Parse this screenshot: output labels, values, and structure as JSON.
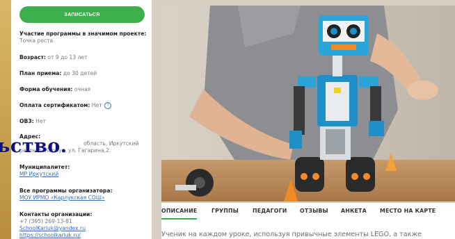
{
  "sidebar": {
    "enroll_button": "ЗАПИСАТЬСЯ",
    "participation_label": "Участие программы в значимом проекте:",
    "participation_value": "Точка роста",
    "age_label": "Возраст:",
    "age_value": "от 9 до 13 лет",
    "plan_label": "План приема:",
    "plan_value": "до 30 детей",
    "form_label": "Форма обучения:",
    "form_value": "очная",
    "cert_label": "Оплата сертификатом:",
    "cert_value": "Нет",
    "ovz_label": "ОВЗ:",
    "ovz_value": "Нет",
    "address_label": "Адрес:",
    "address_line1": "область, Иркутский",
    "address_line2": "район д. Карлук, ул. Гагарина,2",
    "municipality_label": "Муниципалитет:",
    "municipality_value": "МР Иркутский",
    "all_programs_label": "Все программы организатора:",
    "all_programs_value": "МОУ ИРМО «Карлукская СОШ»",
    "contacts_label": "Контакты организации:",
    "phone": "+7 (395) 269-13-81",
    "email": "SchoolKarluk@yandex.ru",
    "website": "https://schoolkarluk.ru/"
  },
  "overlay_text": "ьство.",
  "tabs": [
    "ОПИСАНИЕ",
    "ГРУППЫ",
    "ПЕДАГОГИ",
    "ОТЗЫВЫ",
    "АНКЕТА",
    "МЕСТО НА КАРТЕ"
  ],
  "description_text": "Ученик на каждом уроке, используя привычные элементы LEGO, а также",
  "colors": {
    "accent": "#3db04b",
    "link": "#3a6fb5",
    "overlay": "#12127a"
  },
  "photo": {
    "icon": "lego-robot-photo"
  }
}
